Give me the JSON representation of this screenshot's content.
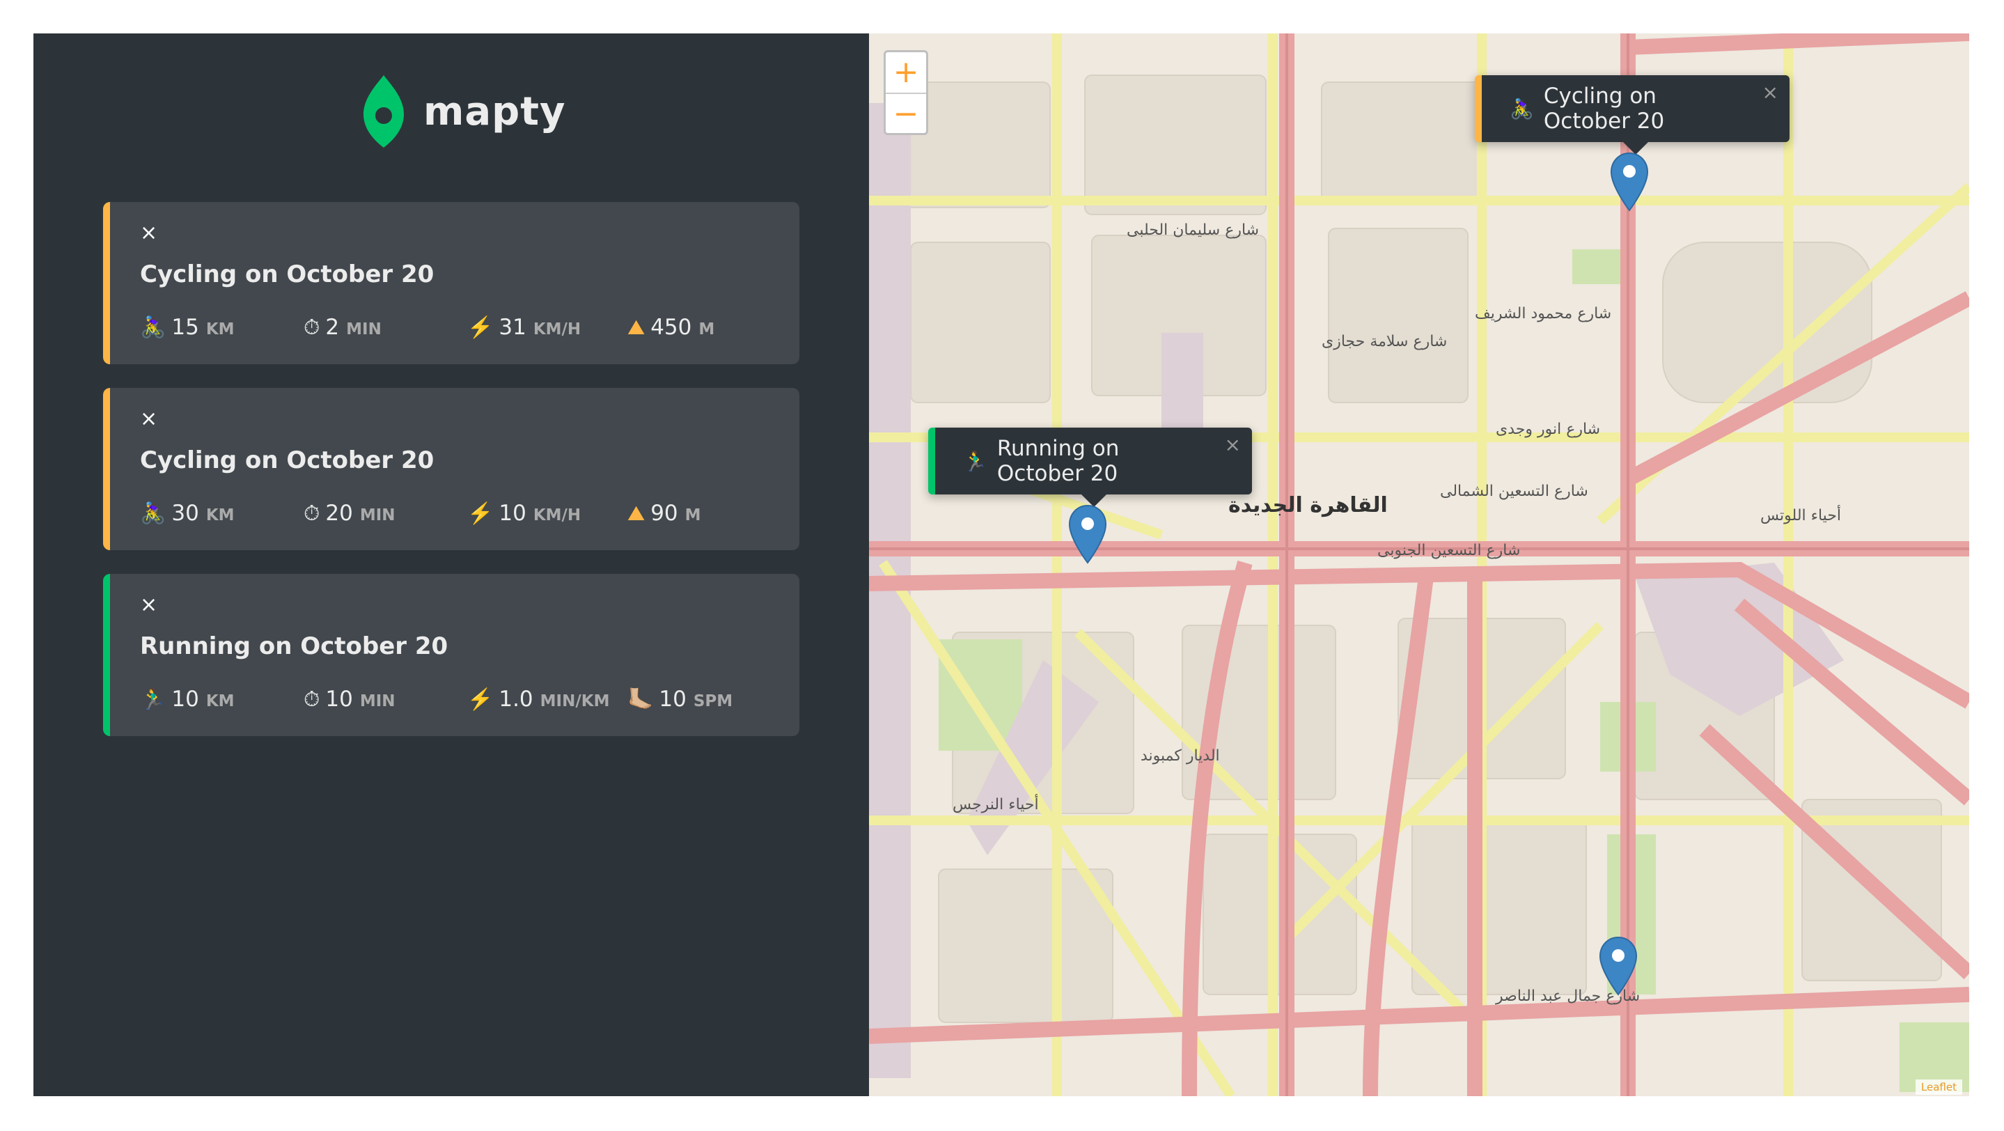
{
  "app": {
    "name": "mapty"
  },
  "colors": {
    "cycling": "#ffb545",
    "running": "#00c46a",
    "sidebar": "#2d3439",
    "card": "#42484d"
  },
  "workouts": [
    {
      "type": "cycling",
      "close": "×",
      "title": "Cycling on October 20",
      "stats": [
        {
          "icon": "cyclist-icon",
          "emoji": "🚴‍♀️",
          "value": "15",
          "unit": "km"
        },
        {
          "icon": "clock-icon",
          "emoji": "⏱",
          "value": "2",
          "unit": "min"
        },
        {
          "icon": "lightning-icon",
          "emoji": "⚡️",
          "value": "31",
          "unit": "km/h"
        },
        {
          "icon": "mountain-icon",
          "emoji": "⛰",
          "value": "450",
          "unit": "m"
        }
      ]
    },
    {
      "type": "cycling",
      "close": "×",
      "title": "Cycling on October 20",
      "stats": [
        {
          "icon": "cyclist-icon",
          "emoji": "🚴‍♀️",
          "value": "30",
          "unit": "km"
        },
        {
          "icon": "clock-icon",
          "emoji": "⏱",
          "value": "20",
          "unit": "min"
        },
        {
          "icon": "lightning-icon",
          "emoji": "⚡️",
          "value": "10",
          "unit": "km/h"
        },
        {
          "icon": "mountain-icon",
          "emoji": "⛰",
          "value": "90",
          "unit": "m"
        }
      ]
    },
    {
      "type": "running",
      "close": "×",
      "title": "Running on October 20",
      "stats": [
        {
          "icon": "runner-icon",
          "emoji": "🏃‍♂️",
          "value": "10",
          "unit": "km"
        },
        {
          "icon": "clock-icon",
          "emoji": "⏱",
          "value": "10",
          "unit": "min"
        },
        {
          "icon": "lightning-icon",
          "emoji": "⚡️",
          "value": "1.0",
          "unit": "min/km"
        },
        {
          "icon": "footprint-icon",
          "emoji": "🦶🏼",
          "value": "10",
          "unit": "spm"
        }
      ]
    }
  ],
  "map": {
    "zoom_in": "+",
    "zoom_out": "−",
    "popups": [
      {
        "type": "cycling",
        "emoji": "🚴‍♀️",
        "label": "Cycling on October 20",
        "close": "×"
      },
      {
        "type": "running",
        "emoji": "🏃‍♂️",
        "label": "Running on October 20",
        "close": "×"
      }
    ],
    "labels": {
      "city": "القاهرة الجديدة",
      "l1": "شارع التسعين الشمالى",
      "l2": "شارع التسعين الجنوبى",
      "l3": "شارع جمال عبد الناصر",
      "l4": "شارع محمود الشريف",
      "l5": "شارع انور وجدى",
      "l6": "أحياء اللوتس",
      "l7": "الديار كمبوند",
      "l8": "أحياء النرجس",
      "l9": "شارع سليمان الحلبى",
      "l10": "شارع سلامة حجازى"
    },
    "attribution": "Leaflet"
  }
}
